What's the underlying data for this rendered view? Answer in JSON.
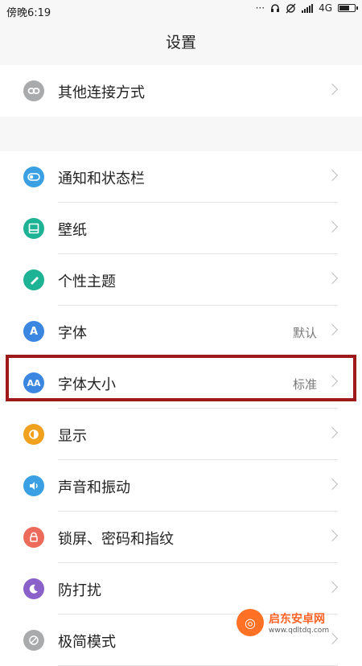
{
  "status_bar": {
    "time": "傍晚6:19",
    "network": "4G",
    "icons": [
      "dots-icon",
      "headset-icon",
      "sync-off-icon",
      "signal-icon",
      "battery-icon"
    ]
  },
  "header": {
    "title": "设置"
  },
  "items": [
    {
      "label": "其他连接方式",
      "icon": "link-icon",
      "color": "#a9aaab",
      "value": ""
    },
    {
      "label": "通知和状态栏",
      "icon": "toggle-icon",
      "color": "#3aa0e3",
      "value": ""
    },
    {
      "label": "壁纸",
      "icon": "wallpaper-icon",
      "color": "#1eb394",
      "value": ""
    },
    {
      "label": "个性主题",
      "icon": "brush-icon",
      "color": "#1eb394",
      "value": ""
    },
    {
      "label": "字体",
      "icon": "font-icon",
      "color": "#3a86e0",
      "value": "默认"
    },
    {
      "label": "字体大小",
      "icon": "font-size-icon",
      "color": "#3a86e0",
      "value": "标准"
    },
    {
      "label": "显示",
      "icon": "display-icon",
      "color": "#f0a11e",
      "value": ""
    },
    {
      "label": "声音和振动",
      "icon": "speaker-icon",
      "color": "#3aa0e3",
      "value": ""
    },
    {
      "label": "锁屏、密码和指纹",
      "icon": "lock-icon",
      "color": "#ee6b5b",
      "value": ""
    },
    {
      "label": "防打扰",
      "icon": "moon-icon",
      "color": "#8a61c8",
      "value": ""
    },
    {
      "label": "极简模式",
      "icon": "minimal-icon",
      "color": "#a9aaab",
      "value": ""
    }
  ],
  "watermark": {
    "main": "启东安卓网",
    "sub": "www.qdltdq.com"
  }
}
